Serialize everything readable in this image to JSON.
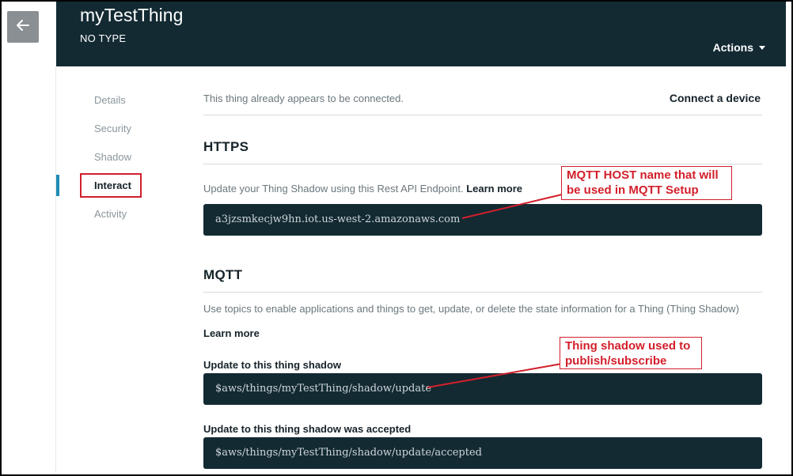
{
  "header": {
    "thing_name": "myTestThing",
    "thing_type": "NO TYPE",
    "actions_label": "Actions"
  },
  "sidenav": {
    "items": [
      {
        "label": "Details"
      },
      {
        "label": "Security"
      },
      {
        "label": "Shadow"
      },
      {
        "label": "Interact",
        "active": true
      },
      {
        "label": "Activity"
      }
    ]
  },
  "main": {
    "connected_text": "This thing already appears to be connected.",
    "connect_device_label": "Connect a device",
    "https": {
      "title": "HTTPS",
      "description": "Update your Thing Shadow using this Rest API Endpoint.",
      "learn_more": "Learn more",
      "endpoint": "a3jzsmkecjw9hn.iot.us-west-2.amazonaws.com"
    },
    "mqtt": {
      "title": "MQTT",
      "description": "Use topics to enable applications and things to get, update, or delete the state information for a Thing (Thing Shadow)",
      "learn_more": "Learn more",
      "topics": [
        {
          "label": "Update to this thing shadow",
          "topic": "$aws/things/myTestThing/shadow/update"
        },
        {
          "label": "Update to this thing shadow was accepted",
          "topic": "$aws/things/myTestThing/shadow/update/accepted"
        }
      ]
    }
  },
  "annotations": {
    "mqtt_host": "MQTT HOST name that will be used in MQTT Setup",
    "thing_shadow": "Thing shadow used to publish/subscribe"
  },
  "colors": {
    "header_bg": "#132a33",
    "accent": "#1f8bb5",
    "annotation_red": "#d21f2b"
  },
  "icons": {
    "back": "arrow-left-icon",
    "actions": "chevron-down-icon"
  }
}
